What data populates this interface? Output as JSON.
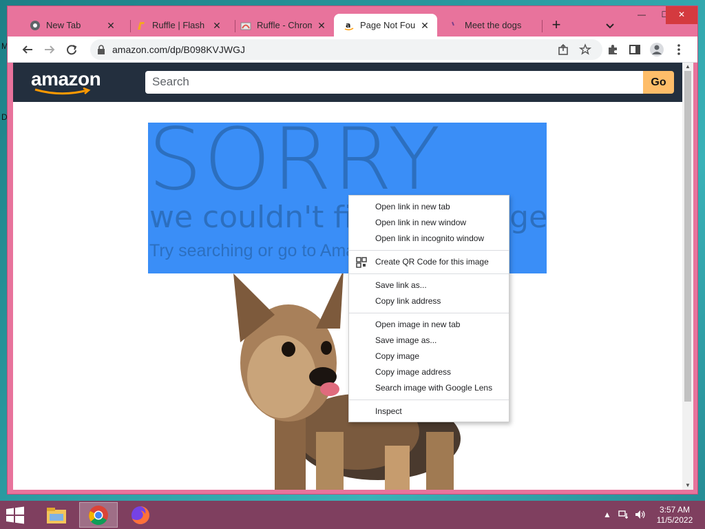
{
  "desktop": {
    "edge_labels": [
      "M",
      "D"
    ]
  },
  "browser": {
    "tabs": [
      {
        "title": "New Tab",
        "favicon": "chrome-icon",
        "active": false
      },
      {
        "title": "Ruffle | Flash Pla",
        "favicon": "ruffle-icon",
        "active": false
      },
      {
        "title": "Ruffle - Chrome",
        "favicon": "chrome-webstore-icon",
        "active": false
      },
      {
        "title": "Page Not Found",
        "favicon": "amazon-icon",
        "active": true
      },
      {
        "title": "Meet the dogs",
        "favicon": "dogs-icon",
        "active": false
      }
    ],
    "new_tab_label": "+",
    "window_controls": {
      "minimize": "—",
      "maximize": "☐",
      "close": "✕"
    },
    "address_bar": {
      "url": "amazon.com/dp/B098KVJWGJ"
    }
  },
  "page": {
    "header": {
      "logo_text": "amazon",
      "search_placeholder": "Search",
      "go_label": "Go"
    },
    "error": {
      "headline": "SORRY",
      "subhead": "we couldn't find that page",
      "hint": "Try searching or go to Amazon's home page."
    }
  },
  "context_menu": {
    "groups": [
      [
        "Open link in new tab",
        "Open link in new window",
        "Open link in incognito window"
      ],
      [
        "Create QR Code for this image"
      ],
      [
        "Save link as...",
        "Copy link address"
      ],
      [
        "Open image in new tab",
        "Save image as...",
        "Copy image",
        "Copy image address",
        "Search image with Google Lens"
      ],
      [
        "Inspect"
      ]
    ]
  },
  "taskbar": {
    "apps": [
      "file-explorer-icon",
      "chrome-icon",
      "firefox-icon"
    ],
    "clock": {
      "time": "3:57 AM",
      "date": "11/5/2022"
    }
  },
  "colors": {
    "window_frame": "#e8739c",
    "amazon_header": "#232f3e",
    "amazon_go": "#febd69",
    "selection_blue": "#3a8ef7",
    "taskbar": "#7f3f5f"
  }
}
